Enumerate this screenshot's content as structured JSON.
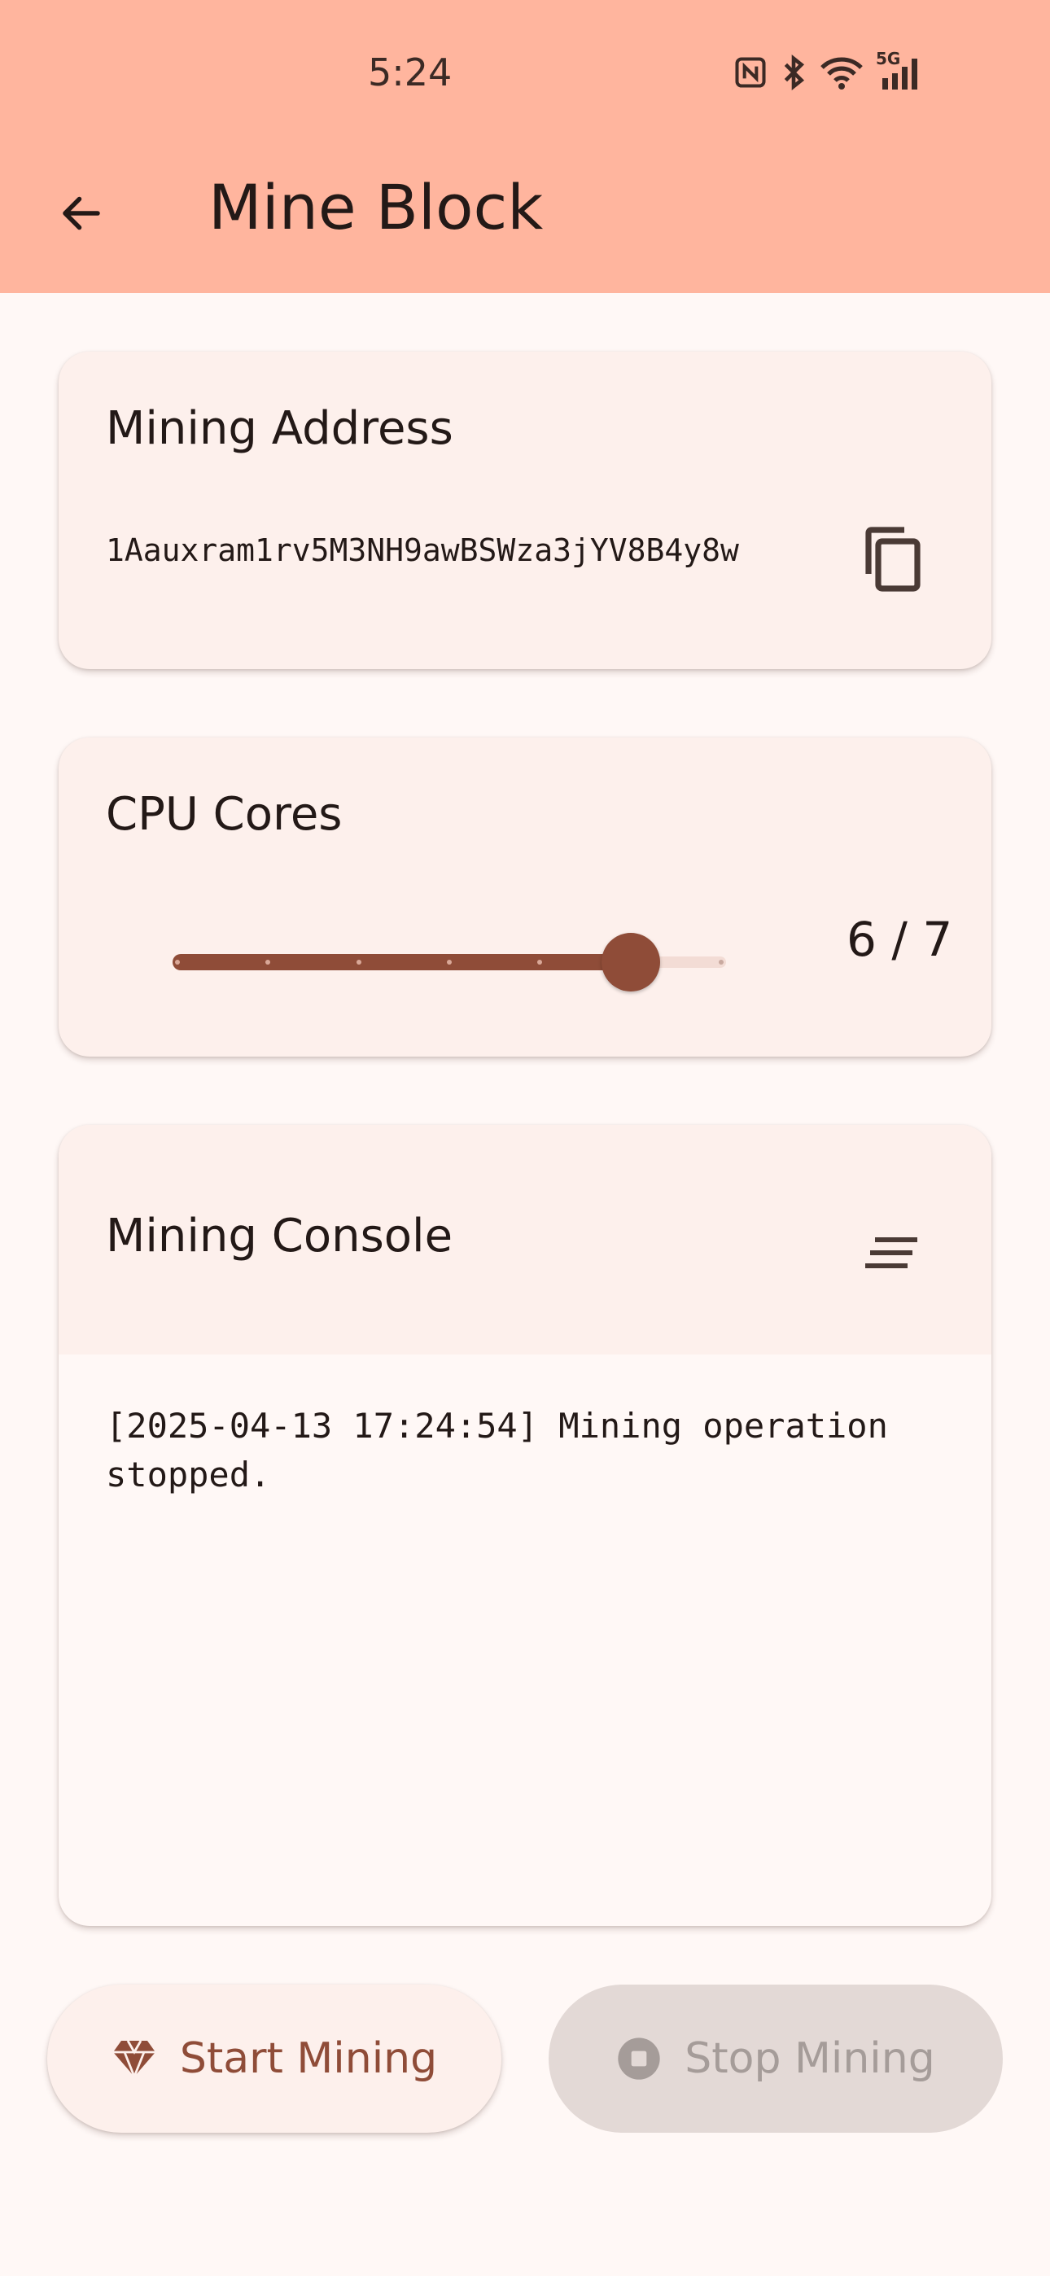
{
  "status_bar": {
    "time": "5:24",
    "icons": [
      "nfc-icon",
      "bluetooth-icon",
      "wifi-icon",
      "5g-signal-icon"
    ],
    "network_label": "5G"
  },
  "app_bar": {
    "title": "Mine Block",
    "back_icon": "arrow-left-icon",
    "background": "#ffb59e"
  },
  "address_card": {
    "title": "Mining Address",
    "address": "1Aauxram1rv5M3NH9awBSWza3jYV8B4y8w",
    "copy_icon": "copy-icon"
  },
  "cpu_card": {
    "title": "CPU Cores",
    "slider": {
      "value": 6,
      "max": 7,
      "min": 1
    },
    "value_label": "6 / 7"
  },
  "console_card": {
    "title": "Mining Console",
    "clear_icon": "clear-all-icon",
    "log": "[2025-04-13 17:24:54] Mining operation stopped."
  },
  "actions": {
    "start_label": "Start Mining",
    "start_icon": "diamond-icon",
    "stop_label": "Stop Mining",
    "stop_icon": "stop-icon",
    "stop_enabled": false
  },
  "colors": {
    "accent": "#8f4c38",
    "surface": "#fff8f6",
    "card": "#fdf0ec",
    "disabled_bg": "#e3d9d6",
    "disabled_text": "#a59c99"
  }
}
